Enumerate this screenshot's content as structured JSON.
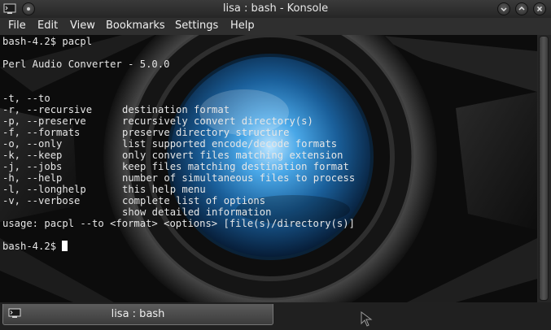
{
  "window": {
    "title": "lisa : bash - Konsole"
  },
  "menu": {
    "items": [
      "File",
      "Edit",
      "View",
      "Bookmarks",
      "Settings",
      "Help"
    ]
  },
  "terminal": {
    "prompt_command": "bash-4.2$ pacpl",
    "app_title": "Perl Audio Converter - 5.0.0",
    "options": [
      {
        "flag": "-t, --to",
        "desc": "destination format"
      },
      {
        "flag": "-r, --recursive",
        "desc": "recursively convert directory(s)"
      },
      {
        "flag": "-p, --preserve",
        "desc": "preserve directory structure"
      },
      {
        "flag": "-f, --formats",
        "desc": "list supported encode/decode formats"
      },
      {
        "flag": "-o, --only",
        "desc": "only convert files matching extension"
      },
      {
        "flag": "-k, --keep",
        "desc": "keep files matching destination format"
      },
      {
        "flag": "-j, --jobs",
        "desc": "number of simultaneous files to process"
      },
      {
        "flag": "-h, --help",
        "desc": "this help menu"
      },
      {
        "flag": "-l, --longhelp",
        "desc": "complete list of options"
      },
      {
        "flag": "-v, --verbose",
        "desc": "show detailed information"
      }
    ],
    "usage": "usage: pacpl --to <format> <options> [file(s)/directory(s)]",
    "final_prompt": "bash-4.2$ "
  },
  "tabs": [
    {
      "label": "lisa : bash",
      "icon": "terminal-icon"
    }
  ],
  "colors": {
    "terminal_text": "#e6e6e6",
    "lens_blue": "#1e7fc0"
  }
}
